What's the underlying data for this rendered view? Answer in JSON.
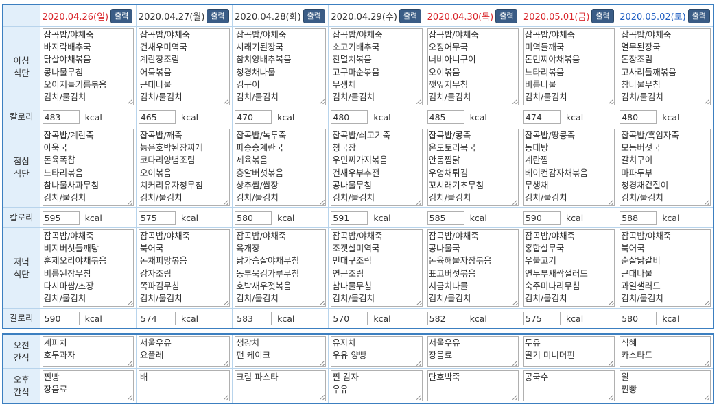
{
  "print_label": "출력",
  "unit_label": "kcal",
  "labels": {
    "breakfast": [
      "아침",
      "식단"
    ],
    "lunch": [
      "점심",
      "식단"
    ],
    "dinner": [
      "저녁",
      "식단"
    ],
    "calorie": "칼로리",
    "am_snack": [
      "오전",
      "간식"
    ],
    "pm_snack": [
      "오후",
      "간식"
    ]
  },
  "days": [
    {
      "date": "2020.04.26(일)",
      "type": "sun",
      "breakfast": [
        "잡곡밥/야채죽",
        "바지락배추국",
        "닭살야채볶음",
        "콩나물무침",
        "오이지들기름볶음",
        "김치/물김치"
      ],
      "breakfast_kcal": "483",
      "lunch": [
        "잡곡밥/계란죽",
        "아욱국",
        "돈육폭찹",
        "느타리볶음",
        "참나물사과무침",
        "김치/물김치"
      ],
      "lunch_kcal": "595",
      "dinner": [
        "잡곡밥/야채죽",
        "비지버섯들깨탕",
        "훈제오리야채볶음",
        "비름된장무침",
        "다시마쌈/초장",
        "김치/물김치"
      ],
      "dinner_kcal": "590",
      "am_snack": [
        "계피차",
        "호두과자"
      ],
      "pm_snack": [
        "찐빵",
        "장음료"
      ]
    },
    {
      "date": "2020.04.27(월)",
      "type": "wd",
      "breakfast": [
        "잡곡밥/야채죽",
        "건새우미역국",
        "계란장조림",
        "어묵볶음",
        "근대나물",
        "김치/물김치"
      ],
      "breakfast_kcal": "465",
      "lunch": [
        "잡곡밥/깨죽",
        "늙은호박된장찌개",
        "코다리양념조림",
        "오이볶음",
        "치커리유자청무침",
        "김치/물김치"
      ],
      "lunch_kcal": "575",
      "dinner": [
        "잡곡밥/야채죽",
        "북어국",
        "돈채피망볶음",
        "감자조림",
        "쪽파김무침",
        "김치/물김치"
      ],
      "dinner_kcal": "574",
      "am_snack": [
        "서울우유",
        "요플레"
      ],
      "pm_snack": [
        "배"
      ]
    },
    {
      "date": "2020.04.28(화)",
      "type": "wd",
      "breakfast": [
        "잡곡밥/야채죽",
        "시래기된장국",
        "참치양배추볶음",
        "청경채나물",
        "김구이",
        "김치/물김치"
      ],
      "breakfast_kcal": "470",
      "lunch": [
        "잡곡밥/녹두죽",
        "파송송계란국",
        "제육볶음",
        "층알버섯볶음",
        "상추쌈/쌈장",
        "김치/물김치"
      ],
      "lunch_kcal": "580",
      "dinner": [
        "잡곡밥/야채죽",
        "육개장",
        "닭가슴살야채무침",
        "동부묵김가루무침",
        "호박새우젓볶음",
        "김치/물김치"
      ],
      "dinner_kcal": "583",
      "am_snack": [
        "생강차",
        "팬 케이크"
      ],
      "pm_snack": [
        "크림 파스타"
      ]
    },
    {
      "date": "2020.04.29(수)",
      "type": "wd",
      "breakfast": [
        "잡곡밥/야채죽",
        "소고기배추국",
        "잔멸치볶음",
        "고구마순볶음",
        "무생채",
        "김치/물김치"
      ],
      "breakfast_kcal": "480",
      "lunch": [
        "잡곡밥/쇠고기죽",
        "청국장",
        "우민찌가지볶음",
        "건새우부추전",
        "콩나물무침",
        "김치/물김치"
      ],
      "lunch_kcal": "591",
      "dinner": [
        "잡곡밥/야채죽",
        "조갯살미역국",
        "민대구조림",
        "연근조림",
        "참나물무침",
        "김치/물김치"
      ],
      "dinner_kcal": "570",
      "am_snack": [
        "유자차",
        "우유 양빵"
      ],
      "pm_snack": [
        "찐 감자",
        "우유"
      ]
    },
    {
      "date": "2020.04.30(목)",
      "type": "hol",
      "breakfast": [
        "잡곡밥/야채죽",
        "오징어무국",
        "너비아니구이",
        "오이볶음",
        "깻잎지무침",
        "김치/물김치"
      ],
      "breakfast_kcal": "485",
      "lunch": [
        "잡곡밥/콩죽",
        "온도토리묵국",
        "안동찜닭",
        "우엉채튀김",
        "꼬시래기초무침",
        "김치/물김치"
      ],
      "lunch_kcal": "585",
      "dinner": [
        "잡곡밥/야채죽",
        "콩나물국",
        "돈육해물자장볶음",
        "표고버섯볶음",
        "시금치나물",
        "김치/물김치"
      ],
      "dinner_kcal": "582",
      "am_snack": [
        "서울우유",
        "장음료"
      ],
      "pm_snack": [
        "단호박죽"
      ]
    },
    {
      "date": "2020.05.01(금)",
      "type": "hol",
      "breakfast": [
        "잡곡밥/야채죽",
        "미역들깨국",
        "돈민찌야채볶음",
        "느타리볶음",
        "비름나물",
        "김치/물김치"
      ],
      "breakfast_kcal": "474",
      "lunch": [
        "잡곡밥/땅콩죽",
        "동태탕",
        "계란찜",
        "베이컨감자채볶음",
        "무생채",
        "김치/물김치"
      ],
      "lunch_kcal": "590",
      "dinner": [
        "잡곡밥/야채죽",
        "홍합살무국",
        "우불고기",
        "연두부새싹샐러드",
        "숙주미나리무침",
        "김치/물김치"
      ],
      "dinner_kcal": "575",
      "am_snack": [
        "두유",
        "딸기 미니머핀"
      ],
      "pm_snack": [
        "콩국수"
      ]
    },
    {
      "date": "2020.05.02(토)",
      "type": "sat",
      "breakfast": [
        "잡곡밥/야채죽",
        "열무된장국",
        "돈장조림",
        "고사리들깨볶음",
        "참나물무침",
        "김치/물김치"
      ],
      "breakfast_kcal": "480",
      "lunch": [
        "잡곡밥/흑임자죽",
        "모듬버섯국",
        "갈치구이",
        "마파두부",
        "청경채겉절이",
        "김치/물김치"
      ],
      "lunch_kcal": "588",
      "dinner": [
        "잡곡밥/야채죽",
        "북어국",
        "순살닭갈비",
        "근대나물",
        "과일샐러드",
        "김치/물김치"
      ],
      "dinner_kcal": "580",
      "am_snack": [
        "식혜",
        "카스타드"
      ],
      "pm_snack": [
        "윌",
        "찐빵"
      ]
    }
  ]
}
